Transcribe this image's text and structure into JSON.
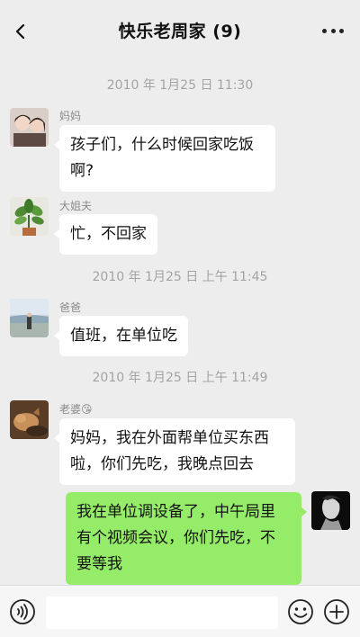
{
  "header": {
    "title": "快乐老周家 (9)"
  },
  "messages": [
    {
      "type": "timestamp",
      "text": "2010 年 1月25 日 11:30"
    },
    {
      "type": "incoming",
      "sender": "妈妈",
      "lines": [
        "孩子们，什么时候回家吃饭",
        "啊?"
      ]
    },
    {
      "type": "incoming",
      "sender": "大姐夫",
      "lines": [
        "忙，不回家"
      ]
    },
    {
      "type": "timestamp",
      "text": "2010 年 1月25 日 上午 11:45"
    },
    {
      "type": "incoming",
      "sender": "爸爸",
      "lines": [
        "值班，在单位吃"
      ]
    },
    {
      "type": "timestamp",
      "text": "2010 年 1月25 日 上午 11:49"
    },
    {
      "type": "incoming",
      "sender": "老婆",
      "sender_emoji": "😘",
      "lines": [
        "妈妈，我在外面帮单位买东西",
        "啦，你们先吃，我晚点回去"
      ]
    },
    {
      "type": "outgoing",
      "lines": [
        "我在单位调设备了，中午局里",
        "有个视频会议，你们先吃，不",
        "要等我"
      ]
    }
  ],
  "input": {
    "value": "",
    "placeholder": ""
  },
  "icons": {
    "back": "chevron-left-icon",
    "more": "more-dots-icon",
    "voice": "voice-icon",
    "emoji": "emoji-icon",
    "plus": "plus-icon"
  },
  "colors": {
    "background": "#ededed",
    "incoming_bubble": "#ffffff",
    "outgoing_bubble": "#95ec69",
    "timestamp": "#a3a3a3",
    "sender_name": "#8a8a8a"
  }
}
